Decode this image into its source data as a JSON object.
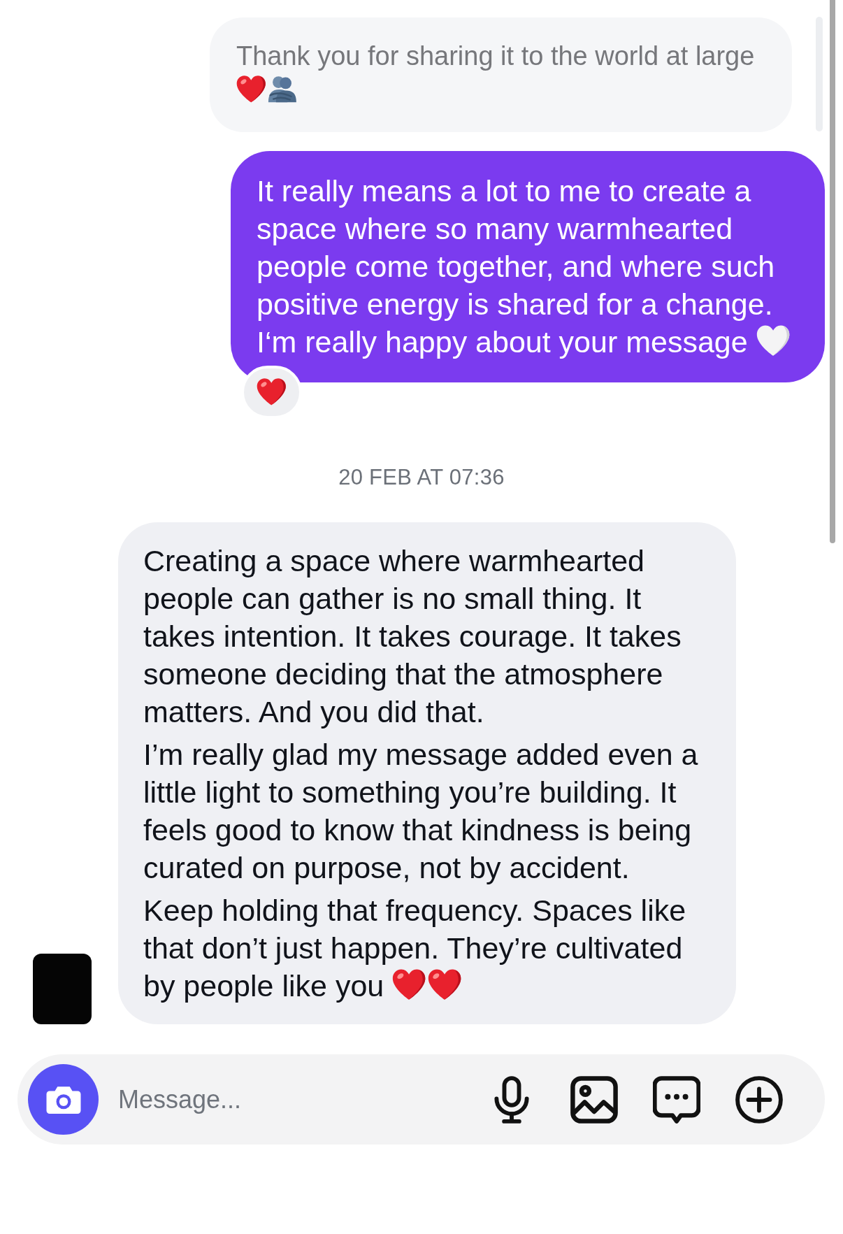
{
  "thread": {
    "messages": [
      {
        "kind": "quote",
        "paragraphs": [
          "Thank you for sharing it to the world at large"
        ],
        "closing": {
          "emoji": [
            {
              "kind": "red-heart"
            },
            {
              "kind": "people-hugging"
            }
          ]
        }
      },
      {
        "kind": "sent",
        "paragraphs": [
          "It really means a lot to me to create a space where so many warmhearted people come together, and where such positive energy is shared for a change."
        ],
        "closing": {
          "text": "I‘m really happy about your message",
          "emoji": [
            {
              "kind": "white-heart"
            }
          ]
        },
        "reactions": [
          {
            "kind": "red-heart"
          }
        ]
      },
      {
        "kind": "timestamp",
        "text": "20 FEB AT 07:36"
      },
      {
        "kind": "received",
        "paragraphs": [
          "Creating a space where warmhearted people can gather is no small thing. It takes intention. It takes courage. It takes someone deciding that the atmosphere matters. And you did that.",
          "I’m really glad my message added even a little light to something you’re building. It feels good to know that kindness is being curated on purpose, not by accident.",
          "Keep holding that frequency. Spaces like that don’t just happen. They’re cultivated"
        ],
        "closing": {
          "text": "by people like you",
          "emoji": [
            {
              "kind": "red-heart"
            },
            {
              "kind": "red-heart"
            }
          ]
        }
      }
    ]
  },
  "composer": {
    "placeholder": "Message..."
  }
}
